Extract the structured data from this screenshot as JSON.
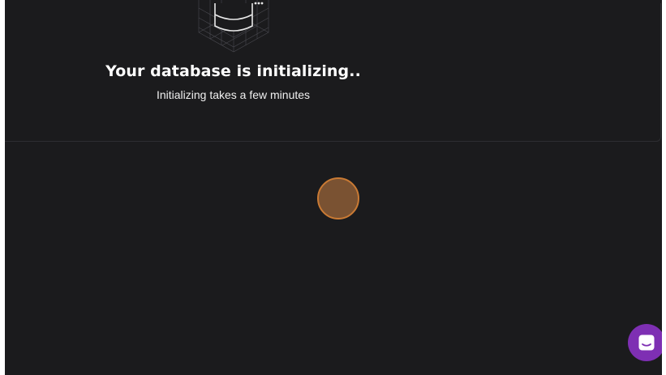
{
  "init_card": {
    "title": "Your database is initializing..",
    "subtitle": "Initializing takes a few minutes"
  },
  "icons": {
    "illustration": "database-icon",
    "chat": "chat-launcher-icon"
  },
  "colors": {
    "background": "#1b1b1d",
    "card_border": "#2e2e32",
    "chat_launcher": "#7e2fb3",
    "cursor_fill": "#7a5232",
    "cursor_ring": "#c97a34"
  }
}
